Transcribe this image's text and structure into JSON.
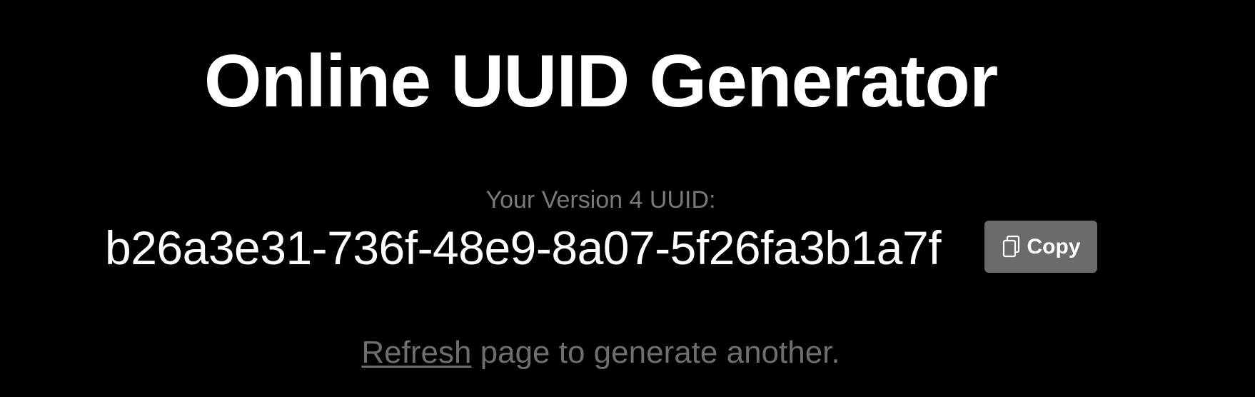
{
  "page": {
    "title": "Online UUID Generator"
  },
  "uuid": {
    "label": "Your Version 4 UUID:",
    "value": "b26a3e31-736f-48e9-8a07-5f26fa3b1a7f"
  },
  "copy": {
    "icon": "copy-icon",
    "label": "Copy"
  },
  "refresh": {
    "link_label": "Refresh",
    "text": " page to generate another."
  },
  "colors": {
    "background": "#000000",
    "title": "#ffffff",
    "muted_text": "#7a7a7a",
    "button_bg": "#6b6b6b"
  }
}
